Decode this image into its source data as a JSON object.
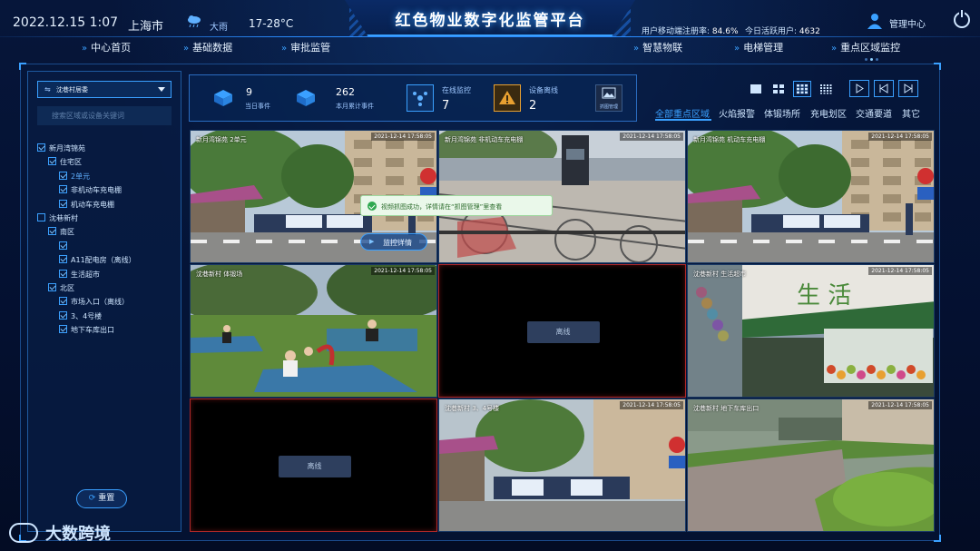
{
  "header": {
    "date_time": "2022.12.15   1:07",
    "city": "上海市",
    "weather": "大雨",
    "temperature": "17-28°C",
    "title": "红色物业数字化监管平台",
    "mobile_reg_label": "用户移动端注册率:",
    "mobile_reg_value": "84.6%",
    "active_users_label": "今日活跃用户:",
    "active_users_value": "4632",
    "manager": "管理中心",
    "nav_left": [
      "中心首页",
      "基础数据",
      "审批监管"
    ],
    "nav_right": [
      "智慧物联",
      "电梯管理",
      "重点区域监控"
    ]
  },
  "sidebar": {
    "select_value": "沈巷村居委",
    "search_placeholder": "搜索区域或设备关键词",
    "tree": [
      {
        "label": "新月湾锦苑",
        "checked": true
      },
      {
        "label": "住宅区",
        "checked": true
      },
      {
        "label": "2单元",
        "checked": true
      },
      {
        "label": "非机动车充电棚",
        "checked": true
      },
      {
        "label": "机动车充电棚",
        "checked": true
      },
      {
        "label": "沈巷新村",
        "checked": false
      },
      {
        "label": "南区",
        "checked": true
      },
      {
        "label": "",
        "checked": true
      },
      {
        "label": "A11配电房（离线）",
        "checked": true
      },
      {
        "label": "生活超市",
        "checked": true
      },
      {
        "label": "北区",
        "checked": true
      },
      {
        "label": "市场入口（离线）",
        "checked": true
      },
      {
        "label": "3、4号楼",
        "checked": true
      },
      {
        "label": "地下车库出口",
        "checked": true
      }
    ],
    "reset_label": "重置"
  },
  "stats": {
    "today_events_value": "9",
    "today_events_label": "当日事件",
    "month_events_value": "262",
    "month_events_label": "本月累计事件",
    "online_label": "在线监控",
    "online_value": "7",
    "offline_label": "设备离线",
    "offline_value": "2",
    "capture_label": "抓图管理"
  },
  "categories": [
    "全部重点区域",
    "火焰报警",
    "体锻场所",
    "充电划区",
    "交通要道",
    "其它"
  ],
  "cameras": [
    {
      "name": "新月湾锦苑 2单元",
      "ts": "2021-12-14 17:58:05",
      "status": "online"
    },
    {
      "name": "新月湾锦苑 非机动车充电棚",
      "ts": "2021-12-14 17:58:05",
      "status": "online"
    },
    {
      "name": "新月湾锦苑 机动车充电棚",
      "ts": "2021-12-14 17:58:05",
      "status": "online"
    },
    {
      "name": "沈巷新村 体锻场",
      "ts": "2021-12-14 17:58:05",
      "status": "online"
    },
    {
      "name": "",
      "ts": "",
      "status": "offline",
      "offline_label": "离线"
    },
    {
      "name": "沈巷新村 生活超市",
      "ts": "2021-12-14 17:58:05",
      "status": "online"
    },
    {
      "name": "",
      "ts": "",
      "status": "offline",
      "offline_label": "离线"
    },
    {
      "name": "沈巷新村 3、4号楼",
      "ts": "2021-12-14 17:58:05",
      "status": "online"
    },
    {
      "name": "沈巷新村 地下车库出口",
      "ts": "2021-12-14 17:58:05",
      "status": "online"
    }
  ],
  "toast": "视频抓图成功，详情请在“抓图管理”里查看",
  "monitor_button": "监控详情",
  "watermark": "大数跨境",
  "colors": {
    "accent": "#3aa0ff",
    "offline_border": "#b02828",
    "warn": "#e8a030",
    "success": "#2fa84f"
  }
}
